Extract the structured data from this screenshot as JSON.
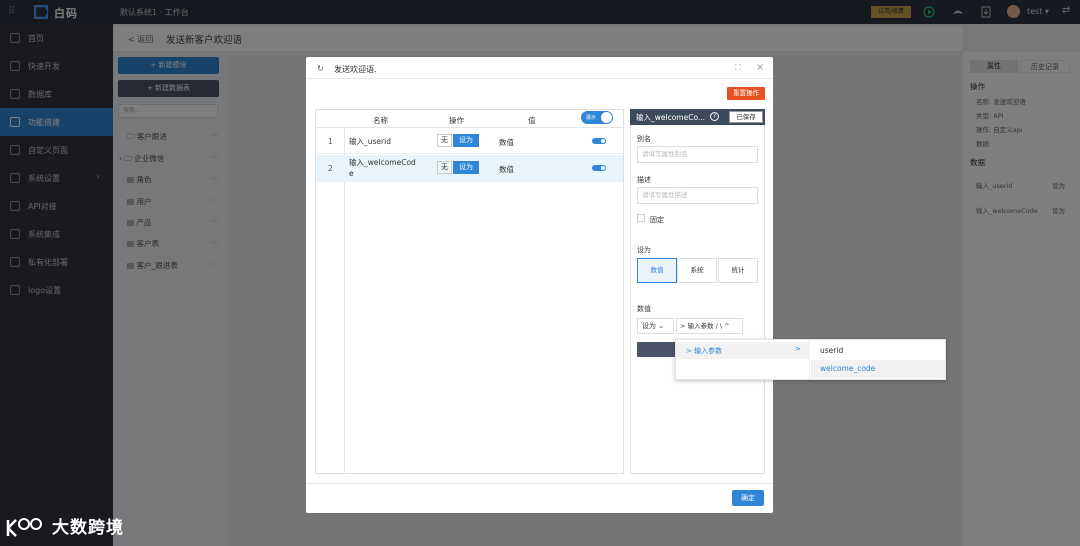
{
  "app": {
    "logo_text": "白码",
    "breadcrumb": "默认系统1 · 工作台",
    "badge": "试用/续费",
    "user": "test ▾"
  },
  "sidebar": {
    "items": [
      {
        "label": "首页"
      },
      {
        "label": "快速开发"
      },
      {
        "label": "数据库"
      },
      {
        "label": "功能搭建"
      },
      {
        "label": "自定义页面"
      },
      {
        "label": "系统设置"
      },
      {
        "label": "API对接"
      },
      {
        "label": "系统集成"
      },
      {
        "label": "私有化部署"
      },
      {
        "label": "logo设置"
      }
    ]
  },
  "page": {
    "back": "< 返回",
    "title": "发送新客户欢迎语"
  },
  "left": {
    "new_module": "+ 新建模块",
    "new_table": "+ 新建数据表",
    "search_placeholder": "搜索...",
    "tree": [
      "客户跟进",
      "企业微信",
      "角色",
      "用户",
      "产品",
      "客户表",
      "客户_跟进表"
    ]
  },
  "right_panel": {
    "tab_props": "属性",
    "tab_history": "历史记录",
    "section_op": "操作",
    "name_line": "名称: 发送欢迎语",
    "type_line": "类型: API",
    "op_line": "操作: 自定义api",
    "data_line": "数据:",
    "section_data": "数据",
    "row1_name": "输入_userid",
    "row1_val": "设为",
    "row2_name": "输入_welcomeCode",
    "row2_val": "设为"
  },
  "modal": {
    "title": "发送欢迎语.",
    "reset": "重置操作",
    "table": {
      "headers": {
        "name": "名称",
        "op": "操作",
        "value": "值"
      },
      "toggle_label": "展示",
      "rows": [
        {
          "idx": "1",
          "name": "输入_userid",
          "none": "无",
          "set": "设为",
          "value": "数值"
        },
        {
          "idx": "2",
          "name": "输入_welcomeCode",
          "none": "无",
          "set": "设为",
          "value": "数值"
        }
      ]
    },
    "prop": {
      "title": "输入_welcomeCo...",
      "saved": "已保存",
      "alias_label": "别名",
      "alias_placeholder": "请填写属性别名",
      "desc_label": "描述",
      "desc_placeholder": "请填写属性描述",
      "fixed_label": "固定",
      "setas_label": "设为",
      "seg": [
        "数值",
        "系统",
        "统计"
      ],
      "num_label": "数值",
      "num_select": "设为 ⌄",
      "param_select": "> 输入参数 / \\ ^"
    },
    "cascader": {
      "group": "> 输入参数",
      "arrow": ">",
      "opt1": "userid",
      "opt2": "welcome_code"
    },
    "ok": "确定"
  },
  "watermark": "大数跨境"
}
